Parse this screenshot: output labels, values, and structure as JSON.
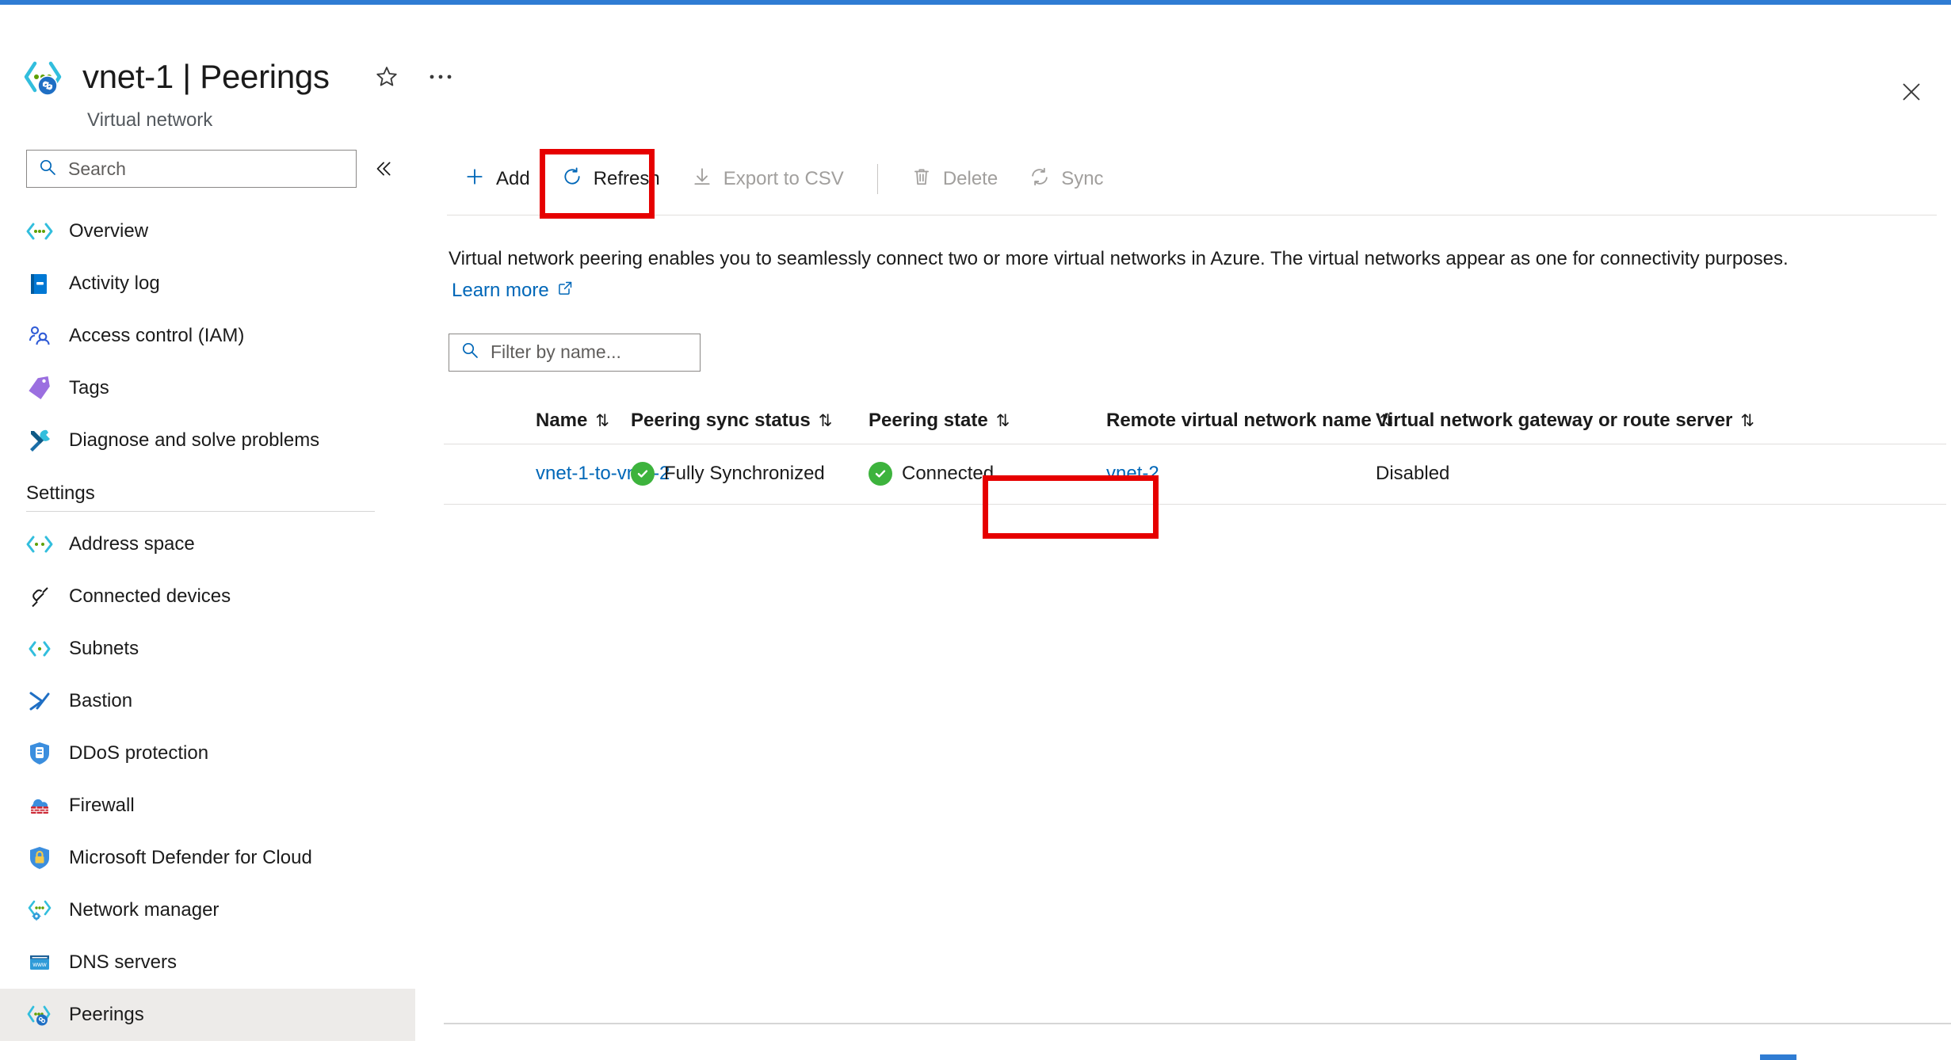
{
  "header": {
    "resource_name": "vnet-1",
    "separator": "|",
    "blade_name": "Peerings",
    "title": "vnet-1 | Peerings",
    "subtitle": "Virtual network",
    "resource_icon": "virtual-network-peering-icon",
    "favorite_icon": "star-icon",
    "more_icon": "ellipsis-icon",
    "close_icon": "close-icon",
    "accent_color": "#2f7cd3"
  },
  "sidebar": {
    "search": {
      "placeholder": "Search",
      "value": "",
      "icon": "search-icon"
    },
    "collapse_icon": "chevron-double-left-icon",
    "items": [
      {
        "label": "Overview",
        "icon": "virtual-network-icon",
        "selected": false
      },
      {
        "label": "Activity log",
        "icon": "activity-log-icon",
        "selected": false
      },
      {
        "label": "Access control (IAM)",
        "icon": "access-control-icon",
        "selected": false
      },
      {
        "label": "Tags",
        "icon": "tags-icon",
        "selected": false
      },
      {
        "label": "Diagnose and solve problems",
        "icon": "diagnose-icon",
        "selected": false
      }
    ],
    "settings_section": "Settings",
    "settings_items": [
      {
        "label": "Address space",
        "icon": "address-space-icon",
        "selected": false
      },
      {
        "label": "Connected devices",
        "icon": "connected-devices-icon",
        "selected": false
      },
      {
        "label": "Subnets",
        "icon": "subnets-icon",
        "selected": false
      },
      {
        "label": "Bastion",
        "icon": "bastion-icon",
        "selected": false
      },
      {
        "label": "DDoS protection",
        "icon": "ddos-protection-icon",
        "selected": false
      },
      {
        "label": "Firewall",
        "icon": "firewall-icon",
        "selected": false
      },
      {
        "label": "Microsoft Defender for Cloud",
        "icon": "defender-icon",
        "selected": false
      },
      {
        "label": "Network manager",
        "icon": "network-manager-icon",
        "selected": false
      },
      {
        "label": "DNS servers",
        "icon": "dns-servers-icon",
        "selected": false
      },
      {
        "label": "Peerings",
        "icon": "peerings-icon",
        "selected": true
      }
    ]
  },
  "toolbar": {
    "add_label": "Add",
    "refresh_label": "Refresh",
    "export_label": "Export to CSV",
    "delete_label": "Delete",
    "sync_label": "Sync",
    "add_icon": "plus-icon",
    "refresh_icon": "refresh-icon",
    "export_icon": "download-icon",
    "delete_icon": "trash-icon",
    "sync_icon": "sync-icon"
  },
  "description": {
    "text": "Virtual network peering enables you to seamlessly connect two or more virtual networks in Azure. The virtual networks appear as one for connectivity purposes.",
    "learn_more": "Learn more",
    "learn_more_icon": "external-link-icon"
  },
  "filter": {
    "placeholder": "Filter by name...",
    "value": "",
    "icon": "search-icon"
  },
  "table": {
    "sort_icon": "sort-updown-icon",
    "columns": [
      "Name",
      "Peering sync status",
      "Peering state",
      "Remote virtual network name",
      "Virtual network gateway or route server"
    ],
    "rows": [
      {
        "name": "vnet-1-to-vnet-2",
        "sync_status": "Fully Synchronized",
        "sync_status_icon": "check-circle-green-icon",
        "peering_state": "Connected",
        "peering_state_icon": "check-circle-green-icon",
        "remote_vnet": "vnet-2",
        "gateway": "Disabled"
      }
    ]
  },
  "highlights": {
    "refresh_box_color": "#e60000",
    "connected_box_color": "#e60000"
  },
  "colors": {
    "link": "#0067b8",
    "success": "#3db33d",
    "accent": "#2f7cd3",
    "disabled_text": "#a19f9d"
  }
}
